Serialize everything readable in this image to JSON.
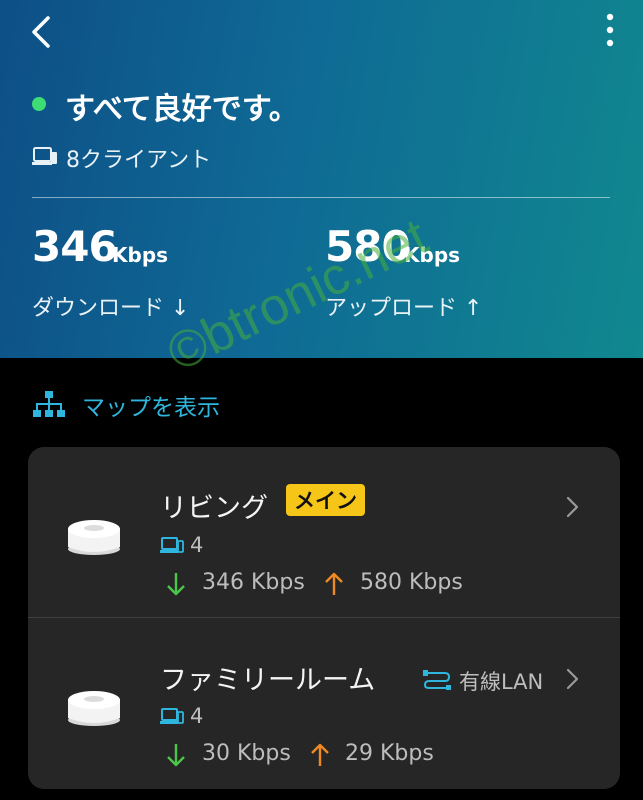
{
  "header": {
    "status_text": "すべて良好です。",
    "clients_text": "8クライアント",
    "download": {
      "value": "346",
      "unit": "Kbps",
      "label": "ダウンロード ↓"
    },
    "upload": {
      "value": "580",
      "unit": "Kbps",
      "label": "アップロード ↑"
    }
  },
  "map_link": {
    "label": "マップを表示"
  },
  "watermark": "©btronic.net",
  "devices": [
    {
      "name": "リビング",
      "badge": "メイン",
      "clients": "4",
      "down": "346 Kbps",
      "up": "580 Kbps"
    },
    {
      "name": "ファミリールーム",
      "connection": "有線LAN",
      "clients": "4",
      "down": "30 Kbps",
      "up": "29 Kbps"
    }
  ],
  "colors": {
    "accent": "#2fb6de",
    "status_good": "#3ddc74",
    "down_arrow": "#4cc64a",
    "up_arrow": "#ef8a22",
    "badge": "#f5c518"
  }
}
